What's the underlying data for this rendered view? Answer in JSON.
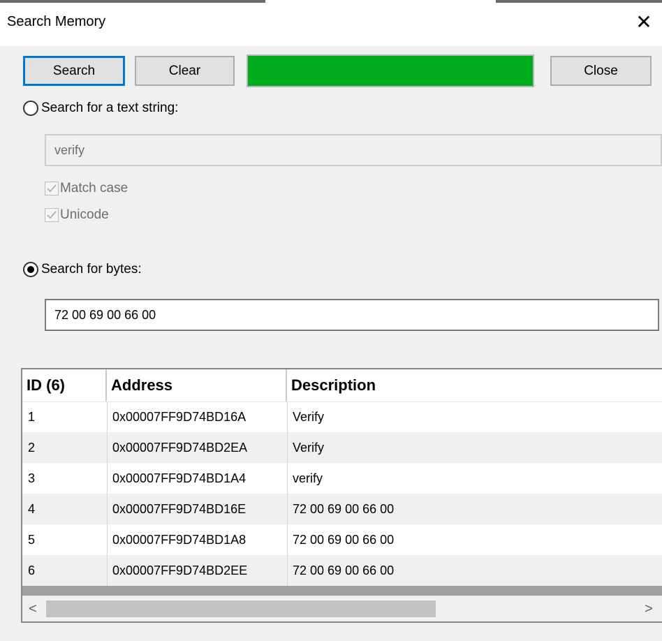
{
  "window": {
    "title": "Search Memory",
    "close_glyph": "✕"
  },
  "toolbar": {
    "search_label": "Search",
    "clear_label": "Clear",
    "close_label": "Close",
    "progress_fraction": 1.0,
    "progress_color": "#00ad1e"
  },
  "text_search": {
    "radio_label": "Search for a text string:",
    "selected": false,
    "value": "verify",
    "match_case_label": "Match case",
    "match_case_checked": true,
    "unicode_label": "Unicode",
    "unicode_checked": true
  },
  "byte_search": {
    "radio_label": "Search for bytes:",
    "selected": true,
    "value": "72 00 69 00 66 00"
  },
  "results": {
    "columns": [
      "ID (6)",
      "Address",
      "Description"
    ],
    "rows": [
      {
        "id": "1",
        "address": "0x00007FF9D74BD16A",
        "description": "Verify"
      },
      {
        "id": "2",
        "address": "0x00007FF9D74BD2EA",
        "description": "Verify"
      },
      {
        "id": "3",
        "address": "0x00007FF9D74BD1A4",
        "description": "verify"
      },
      {
        "id": "4",
        "address": "0x00007FF9D74BD16E",
        "description": "72 00 69 00 66 00"
      },
      {
        "id": "5",
        "address": "0x00007FF9D74BD1A8",
        "description": "72 00 69 00 66 00"
      },
      {
        "id": "6",
        "address": "0x00007FF9D74BD2EE",
        "description": "72 00 69 00 66 00"
      }
    ],
    "scroll_left_glyph": "<",
    "scroll_right_glyph": ">"
  }
}
